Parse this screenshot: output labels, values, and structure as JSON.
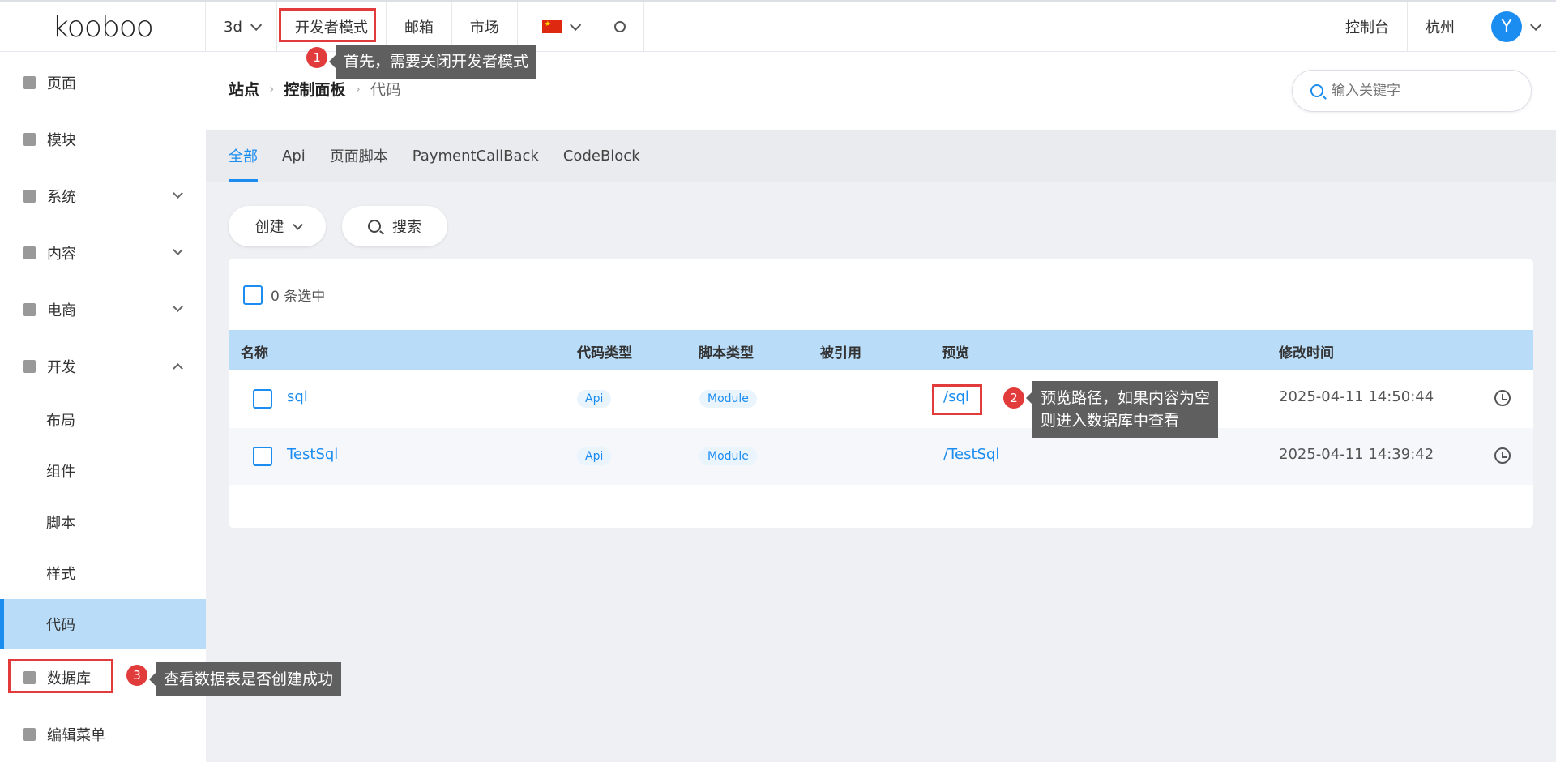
{
  "topbar": {
    "logo": "kooboo",
    "site": "3d",
    "dev_mode": "开发者模式",
    "mail": "邮箱",
    "market": "市场",
    "console": "控制台",
    "region": "杭州",
    "avatar": "Y"
  },
  "sidebar": {
    "items": [
      {
        "label": "页面"
      },
      {
        "label": "模块"
      },
      {
        "label": "系统"
      },
      {
        "label": "内容"
      },
      {
        "label": "电商"
      },
      {
        "label": "开发"
      },
      {
        "label": "布局"
      },
      {
        "label": "组件"
      },
      {
        "label": "脚本"
      },
      {
        "label": "样式"
      },
      {
        "label": "代码"
      },
      {
        "label": "数据库"
      },
      {
        "label": "编辑菜单"
      }
    ]
  },
  "breadcrumb": [
    "站点",
    "控制面板",
    "代码"
  ],
  "search": {
    "placeholder": "输入关键字"
  },
  "tabs": [
    "全部",
    "Api",
    "页面脚本",
    "PaymentCallBack",
    "CodeBlock"
  ],
  "actions": {
    "create": "创建",
    "search": "搜索"
  },
  "table": {
    "selected": "0 条选中",
    "headers": [
      "名称",
      "代码类型",
      "脚本类型",
      "被引用",
      "预览",
      "修改时间"
    ],
    "rows": [
      {
        "name": "sql",
        "code_type": "Api",
        "script_type": "Module",
        "preview": "/sql",
        "modified": "2025-04-11 14:50:44"
      },
      {
        "name": "TestSql",
        "code_type": "Api",
        "script_type": "Module",
        "preview": "/TestSql",
        "modified": "2025-04-11 14:39:42"
      }
    ]
  },
  "callouts": [
    {
      "num": "1",
      "text": "首先，需要关闭开发者模式"
    },
    {
      "num": "2",
      "text1": "预览路径，如果内容为空",
      "text2": "则进入数据库中查看"
    },
    {
      "num": "3",
      "text": "查看数据表是否创建成功"
    }
  ],
  "colors": {
    "accent": "#1b8cf0",
    "highlight": "#e23b3b",
    "active_bg": "#b9dcf8"
  }
}
